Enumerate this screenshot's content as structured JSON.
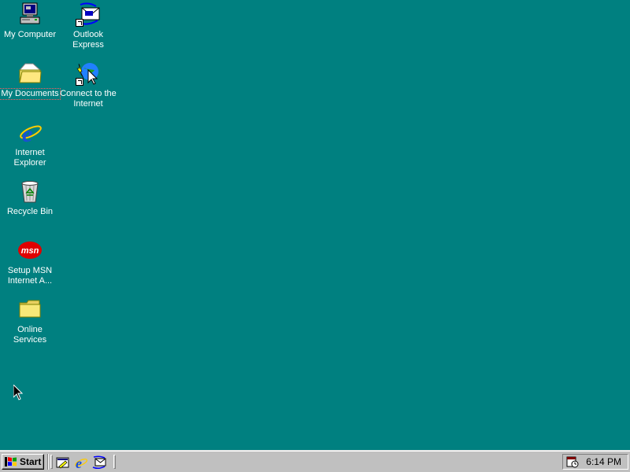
{
  "desktop": {
    "background_color": "#008080",
    "icons": [
      {
        "id": "my-computer",
        "label": "My Computer",
        "icon": "computer-icon"
      },
      {
        "id": "outlook-express",
        "label": "Outlook\nExpress",
        "icon": "outlook-express-icon"
      },
      {
        "id": "my-documents",
        "label": "My Documents",
        "icon": "folder-documents-icon",
        "selected": true
      },
      {
        "id": "connect-internet",
        "label": "Connect to the\nInternet",
        "icon": "connect-wizard-icon"
      },
      {
        "id": "internet-explorer",
        "label": "Internet\nExplorer",
        "icon": "internet-explorer-icon"
      },
      {
        "id": "recycle-bin",
        "label": "Recycle Bin",
        "icon": "recycle-bin-icon"
      },
      {
        "id": "setup-msn",
        "label": "Setup MSN\nInternet A...",
        "icon": "msn-icon"
      },
      {
        "id": "online-services",
        "label": "Online\nServices",
        "icon": "folder-icon"
      }
    ]
  },
  "taskbar": {
    "start_label": "Start",
    "quick_launch": [
      {
        "name": "show-desktop",
        "icon": "show-desktop-icon"
      },
      {
        "name": "internet-explorer",
        "icon": "internet-explorer-icon"
      },
      {
        "name": "outlook-express",
        "icon": "outlook-express-icon"
      }
    ],
    "tray": {
      "icons": [
        "scheduler-icon"
      ],
      "clock": "6:14 PM"
    }
  }
}
